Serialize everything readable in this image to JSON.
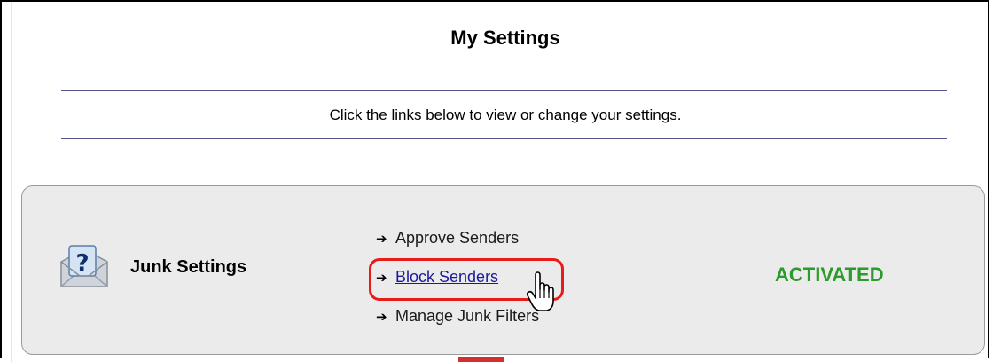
{
  "page": {
    "title": "My Settings",
    "subtitle": "Click the links below to view or change your settings."
  },
  "junk": {
    "label": "Junk Settings",
    "icon": "envelope-question-icon",
    "links": [
      {
        "label": "Approve Senders",
        "icon": "arrow-right-icon"
      },
      {
        "label": "Block Senders",
        "icon": "arrow-right-icon",
        "highlighted": true
      },
      {
        "label": "Manage Junk Filters",
        "icon": "arrow-right-icon"
      }
    ],
    "status": "ACTIVATED"
  },
  "colors": {
    "rule": "#55558a",
    "panel_bg": "#ebebeb",
    "status": "#2b9b2b",
    "highlight": "#e81a1a",
    "link_active": "#1a1a9a"
  }
}
